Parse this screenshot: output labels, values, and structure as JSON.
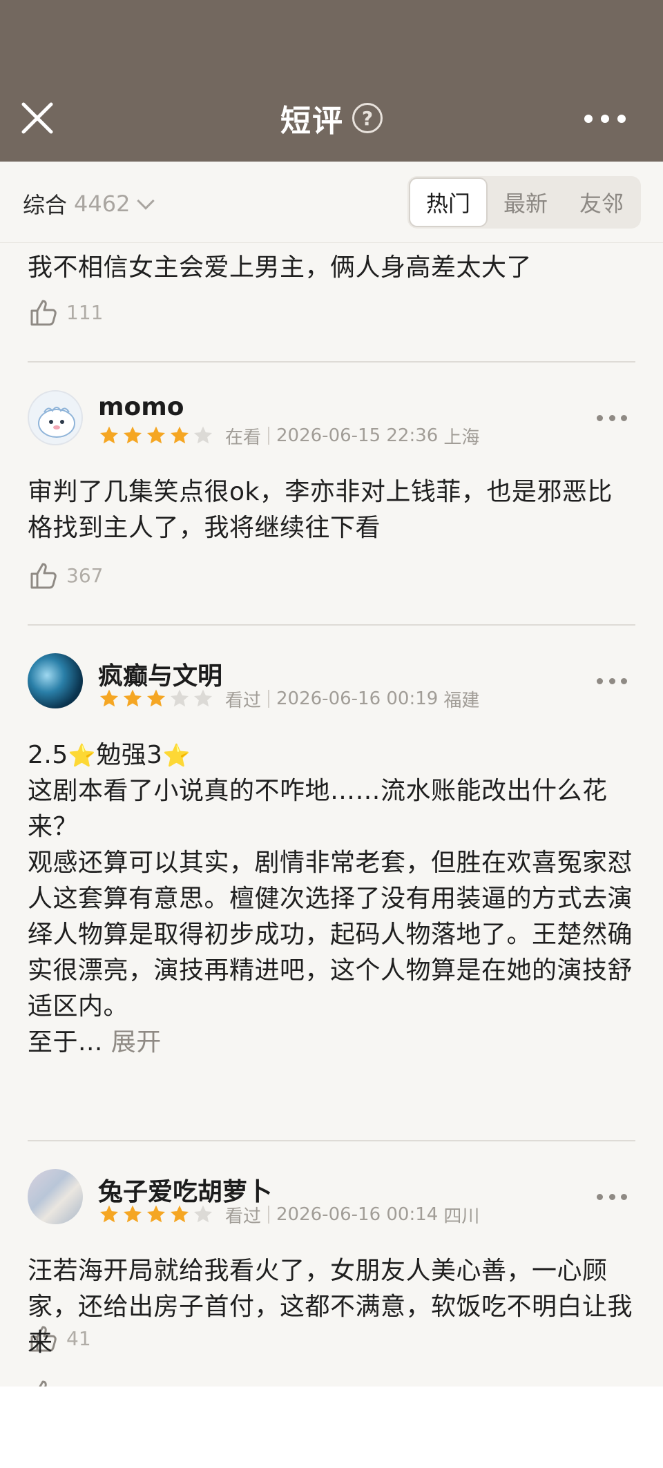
{
  "header": {
    "title": "短评",
    "help_symbol": "?"
  },
  "filter": {
    "sort_label": "综合",
    "count": "4462",
    "tabs": [
      {
        "label": "热门",
        "active": true
      },
      {
        "label": "最新",
        "active": false
      },
      {
        "label": "友邻",
        "active": false
      }
    ]
  },
  "reviews": [
    {
      "content": "我不相信女主会爱上男主，俩人身高差太大了",
      "likes": "111"
    },
    {
      "username": "momo",
      "rating": 4,
      "status": "在看",
      "datetime": "2026-06-15 22:36",
      "location": "上海",
      "content": "审判了几集笑点很ok，李亦非对上钱菲，也是邪恶比格找到主人了，我将继续往下看",
      "likes": "367"
    },
    {
      "username": "疯癫与文明",
      "rating": 3,
      "status": "看过",
      "datetime": "2026-06-16 00:19",
      "location": "福建",
      "content_line1_a": "2.5",
      "content_line1_b": "勉强3",
      "content": "这剧本看了小说真的不咋地……流水账能改出什么花来？\n观感还算可以其实，剧情非常老套，但胜在欢喜冤家怼人这套算有意思。檀健次选择了没有用装逼的方式去演绎人物算是取得初步成功，起码人物落地了。王楚然确实很漂亮，演技再精进吧，这个人物算是在她的演技舒适区内。\n至于...",
      "expand_label": "展开",
      "likes": "41"
    },
    {
      "username": "兔子爱吃胡萝卜",
      "rating": 4,
      "status": "看过",
      "datetime": "2026-06-16 00:14",
      "location": "四川",
      "content": "汪若海开局就给我看火了，女朋友人美心善，一心顾家，还给出房子首付，这都不满意，软饭吃不明白让我来"
    }
  ],
  "colors": {
    "header_bg": "#73685f",
    "star_on": "#f5a623",
    "star_off": "#dcdad6",
    "feed_bg": "#f7f6f3"
  }
}
